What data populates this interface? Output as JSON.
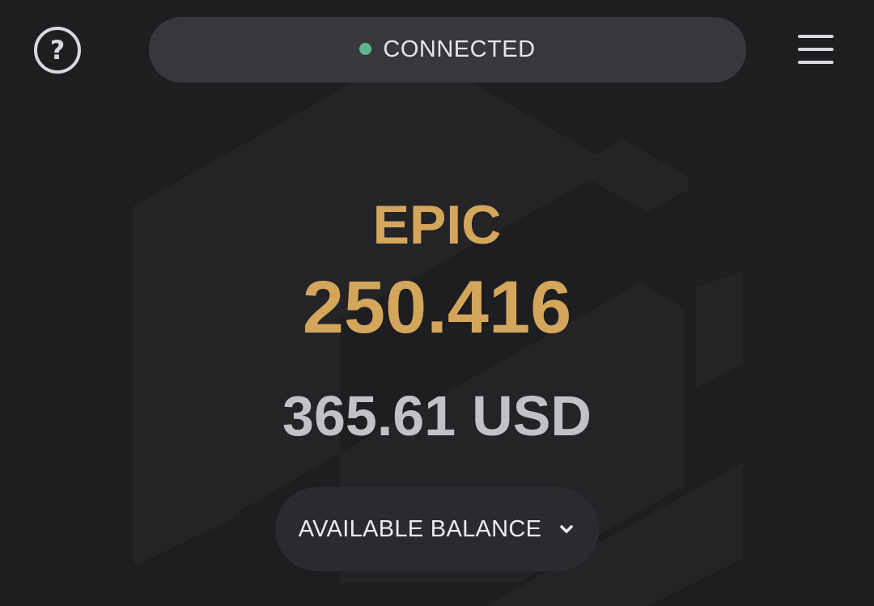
{
  "header": {
    "help_icon": "question-circle-icon",
    "help_glyph": "?",
    "status": {
      "label": "CONNECTED",
      "dot_color": "#5fb48f"
    },
    "menu_icon": "hamburger-menu-icon"
  },
  "balance": {
    "currency": "EPIC",
    "amount": "250.416",
    "fiat_amount": "365.61",
    "fiat_currency": "USD",
    "mode_label": "AVAILABLE BALANCE",
    "mode_icon": "chevron-down-icon"
  },
  "colors": {
    "background": "#1e1e20",
    "accent_gold": "#d4a65c",
    "fiat_text": "#c2c2c6",
    "pill_bg": "#38383c"
  }
}
